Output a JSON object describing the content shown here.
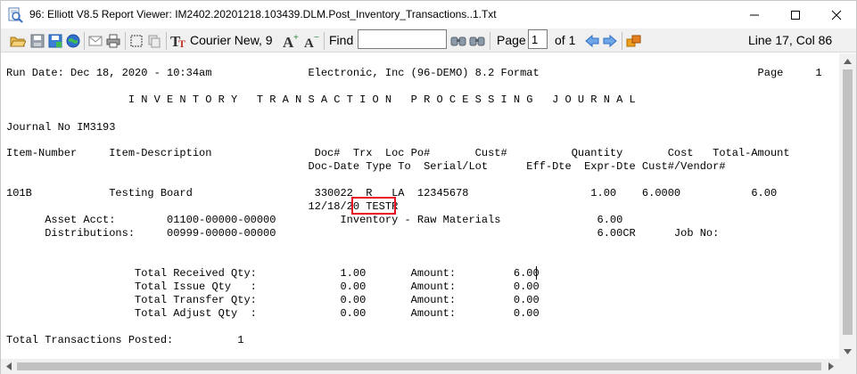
{
  "window": {
    "title": "96: Elliott V8.5 Report Viewer: IM2402.20201218.103439.DLM.Post_Inventory_Transactions..1.Txt",
    "controls": {
      "minimize": "—",
      "maximize": "☐",
      "close": "✕"
    }
  },
  "toolbar": {
    "font_label": "Courier New, 9",
    "find_label": "Find",
    "find_value": "",
    "page_label": "Page",
    "page_value": "1",
    "page_total": "of 1",
    "position": "Line 17, Col 86"
  },
  "report": {
    "lines": [
      "Run Date: Dec 18, 2020 - 10:34am               Electronic, Inc (96-DEMO) 8.2 Format                                  Page     1",
      "",
      "                   I N V E N T O R Y   T R A N S A C T I O N   P R O C E S S I N G   J O U R N A L",
      "",
      "Journal No IM3193",
      "",
      "Item-Number     Item-Description                Doc#  Trx  Loc Po#       Cust#          Quantity       Cost   Total-Amount",
      "                                               Doc-Date Type To  Serial/Lot      Eff-Dte  Expr-Dte Cust#/Vendor#",
      "",
      "101B            Testing Board                   330022  R   LA  12345678                   1.00    6.0000           6.00",
      "                                               12/18/20 TESTR",
      "      Asset Acct:        01100-00000-00000          Inventory - Raw Materials               6.00",
      "      Distributions:     00999-00000-00000                                                  6.00CR      Job No:",
      "",
      "",
      "                    Total Received Qty:             1.00       Amount:         6.00",
      "                    Total Issue Qty   :             0.00       Amount:         0.00",
      "                    Total Transfer Qty:             0.00       Amount:         0.00",
      "                    Total Adjust Qty  :             0.00       Amount:         0.00",
      "",
      "Total Transactions Posted:          1"
    ]
  },
  "icons": {
    "app": "report-viewer-icon",
    "colors": {
      "accent": "#1e73d2",
      "highlight": "#e81123"
    }
  }
}
